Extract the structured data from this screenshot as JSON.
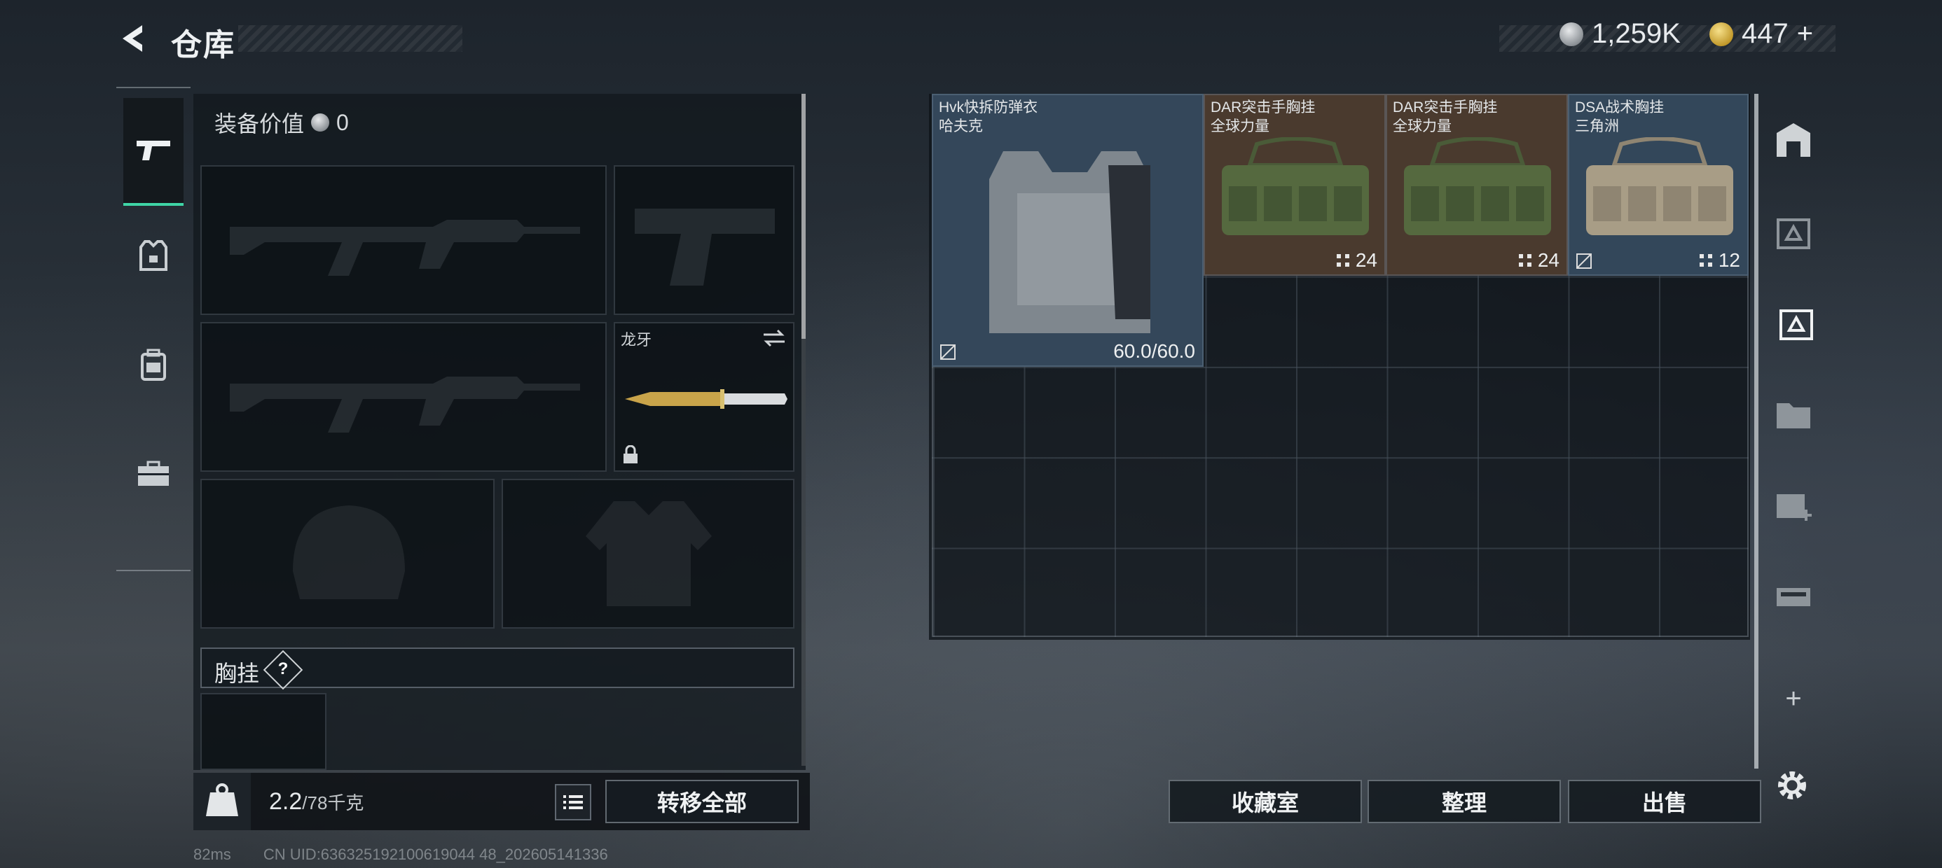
{
  "header": {
    "title": "仓库",
    "currency_silver": "1,259K",
    "currency_gold": "447",
    "add_label": "+"
  },
  "equipment": {
    "value_label": "装备价值",
    "value": "0",
    "melee_name": "龙牙",
    "chest_label": "胸挂",
    "help_label": "?"
  },
  "bottom_left": {
    "weight_current": "2.2",
    "weight_max": "/78千克",
    "transfer_all_label": "转移全部"
  },
  "storage": {
    "items": [
      {
        "name": "Hvk快拆防弹衣\n哈夫克",
        "durability": "60.0/60.0",
        "bg": "#3a4a5a"
      },
      {
        "name": "DAR突击手胸挂\n全球力量",
        "count": "24",
        "bg": "#4a3a2e"
      },
      {
        "name": "DAR突击手胸挂\n全球力量",
        "count": "24",
        "bg": "#4a3a2e"
      },
      {
        "name": "DSA战术胸挂\n三角洲",
        "count": "12",
        "bg": "#33475a"
      }
    ]
  },
  "bottom_right": {
    "collection_label": "收藏室",
    "sort_label": "整理",
    "sell_label": "出售"
  },
  "right_tabs": {
    "tab_plus_label": "+"
  },
  "footer": {
    "ping": "82ms",
    "uid": "CN UID:636325192100619044 48_202605141336"
  },
  "colors": {
    "accent_green": "#3fd5a6",
    "rare_orange_bg": "#4a3a2e",
    "blue_bg": "#3a4a5a"
  }
}
